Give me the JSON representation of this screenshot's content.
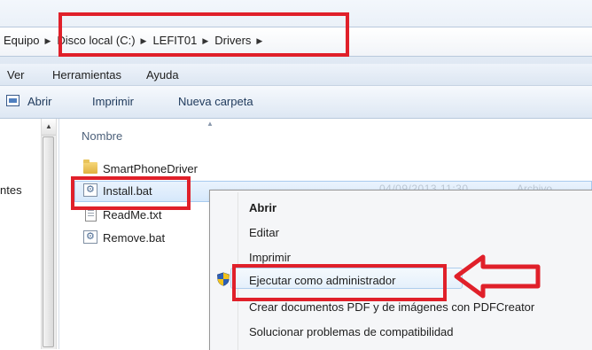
{
  "address": {
    "crumbs": [
      "Equipo",
      "Disco local (C:)",
      "LEFIT01",
      "Drivers"
    ],
    "separator": "▶"
  },
  "menubar": {
    "items": [
      "Ver",
      "Herramientas",
      "Ayuda"
    ]
  },
  "toolbar": {
    "open": "Abrir",
    "print": "Imprimir",
    "new_folder": "Nueva carpeta"
  },
  "nav": {
    "partial_label": "ntes"
  },
  "filelist": {
    "column_name": "Nombre",
    "files": [
      {
        "name": "SmartPhoneDriver",
        "type_icon": "folder-icon"
      },
      {
        "name": "Install.bat",
        "type_icon": "batch-file-icon",
        "selected": true
      },
      {
        "name": "ReadMe.txt",
        "type_icon": "text-file-icon"
      },
      {
        "name": "Remove.bat",
        "type_icon": "batch-file-icon"
      }
    ],
    "selected_date_partial": "04/09/2013 11:30",
    "selected_type_partial": "Archivo"
  },
  "context_menu": {
    "items": [
      {
        "label": "Abrir",
        "bold": true
      },
      {
        "label": "Editar"
      },
      {
        "label": "Imprimir"
      },
      {
        "label": "Ejecutar como administrador",
        "icon": "uac-shield-icon",
        "highlighted": true
      },
      {
        "label": "Crear documentos PDF y de imágenes con PDFCreator"
      },
      {
        "label": "Solucionar problemas de compatibilidad"
      }
    ]
  },
  "colors": {
    "annotation_red": "#e0202a",
    "selection_blue": "#d6e8fb"
  }
}
